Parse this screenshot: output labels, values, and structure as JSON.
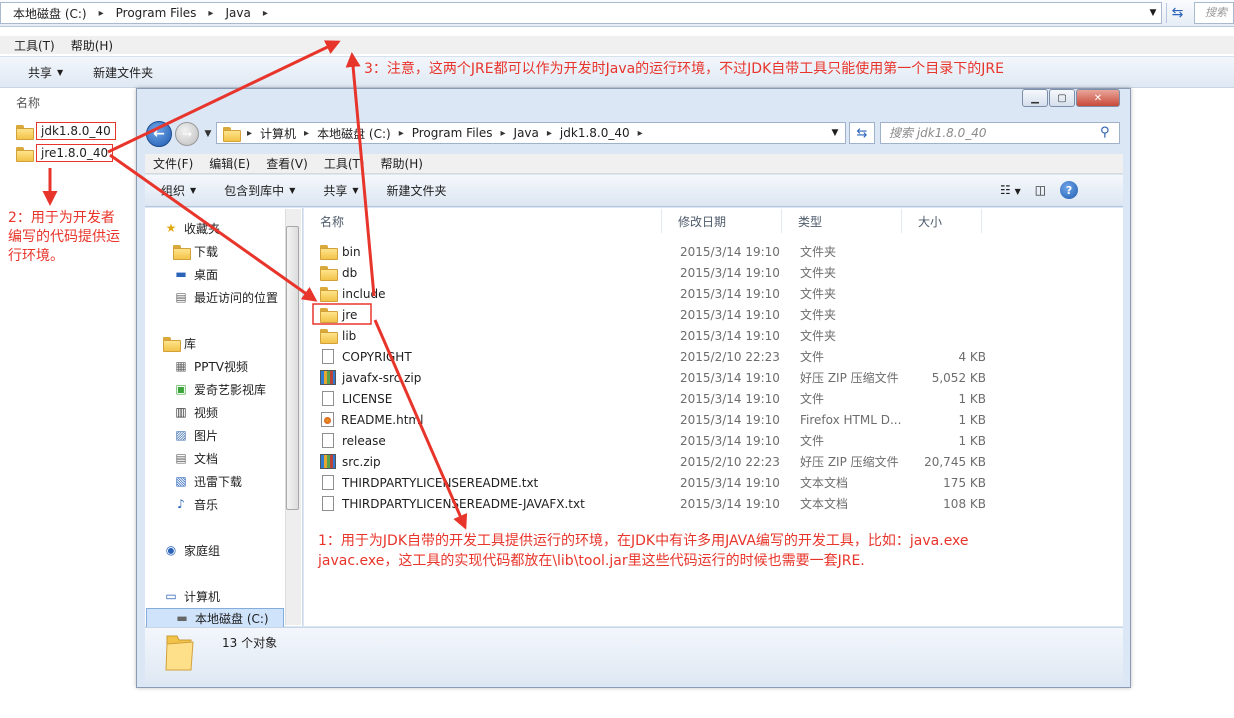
{
  "outer": {
    "breadcrumb": [
      "本地磁盘 (C:)",
      "Program Files",
      "Java"
    ],
    "search_placeholder": "搜索",
    "menu": [
      "工具(T)",
      "帮助(H)"
    ],
    "toolbar": [
      "共享",
      "新建文件夹"
    ],
    "column_name": "名称",
    "items": [
      "jdk1.8.0_40",
      "jre1.8.0_40"
    ]
  },
  "window": {
    "breadcrumb": [
      "计算机",
      "本地磁盘 (C:)",
      "Program Files",
      "Java",
      "jdk1.8.0_40"
    ],
    "search_placeholder": "搜索 jdk1.8.0_40",
    "menu": [
      "文件(F)",
      "编辑(E)",
      "查看(V)",
      "工具(T)",
      "帮助(H)"
    ],
    "toolbar": [
      "组织",
      "包含到库中",
      "共享",
      "新建文件夹"
    ],
    "nav": {
      "favorites": "收藏夹",
      "favorites_items": [
        "下载",
        "桌面",
        "最近访问的位置"
      ],
      "libraries": "库",
      "library_items": [
        "PPTV视频",
        "爱奇艺影视库",
        "视频",
        "图片",
        "文档",
        "迅雷下载",
        "音乐"
      ],
      "homegroup": "家庭组",
      "computer": "计算机",
      "computer_items": [
        "本地磁盘 (C:)"
      ]
    },
    "columns": [
      "名称",
      "修改日期",
      "类型",
      "大小"
    ],
    "files": [
      {
        "name": "bin",
        "date": "2015/3/14 19:10",
        "type": "文件夹",
        "size": "",
        "icon": "folder"
      },
      {
        "name": "db",
        "date": "2015/3/14 19:10",
        "type": "文件夹",
        "size": "",
        "icon": "folder"
      },
      {
        "name": "include",
        "date": "2015/3/14 19:10",
        "type": "文件夹",
        "size": "",
        "icon": "folder"
      },
      {
        "name": "jre",
        "date": "2015/3/14 19:10",
        "type": "文件夹",
        "size": "",
        "icon": "folder"
      },
      {
        "name": "lib",
        "date": "2015/3/14 19:10",
        "type": "文件夹",
        "size": "",
        "icon": "folder"
      },
      {
        "name": "COPYRIGHT",
        "date": "2015/2/10 22:23",
        "type": "文件",
        "size": "4 KB",
        "icon": "doc"
      },
      {
        "name": "javafx-src.zip",
        "date": "2015/3/14 19:10",
        "type": "好压 ZIP 压缩文件",
        "size": "5,052 KB",
        "icon": "zip"
      },
      {
        "name": "LICENSE",
        "date": "2015/3/14 19:10",
        "type": "文件",
        "size": "1 KB",
        "icon": "doc"
      },
      {
        "name": "README.html",
        "date": "2015/3/14 19:10",
        "type": "Firefox HTML D...",
        "size": "1 KB",
        "icon": "html"
      },
      {
        "name": "release",
        "date": "2015/3/14 19:10",
        "type": "文件",
        "size": "1 KB",
        "icon": "doc"
      },
      {
        "name": "src.zip",
        "date": "2015/2/10 22:23",
        "type": "好压 ZIP 压缩文件",
        "size": "20,745 KB",
        "icon": "zip"
      },
      {
        "name": "THIRDPARTYLICENSEREADME.txt",
        "date": "2015/3/14 19:10",
        "type": "文本文档",
        "size": "175 KB",
        "icon": "doc"
      },
      {
        "name": "THIRDPARTYLICENSEREADME-JAVAFX.txt",
        "date": "2015/3/14 19:10",
        "type": "文本文档",
        "size": "108 KB",
        "icon": "doc"
      }
    ],
    "status": "13 个对象"
  },
  "annotations": {
    "note1_line1": "1：用于为JDK自带的开发工具提供运行的环境，在JDK中有许多用JAVA编写的开发工具，比如：java.exe",
    "note1_line2": "javac.exe，这工具的实现代码都放在\\lib\\tool.jar里这些代码运行的时候也需要一套JRE.",
    "note2": [
      "2：用于为开发者",
      "编写的代码提供运",
      "行环境。"
    ],
    "note3": "3：注意，这两个JRE都可以作为开发时Java的运行环境，不过JDK自带工具只能使用第一个目录下的JRE",
    "color": "#e8352b"
  }
}
